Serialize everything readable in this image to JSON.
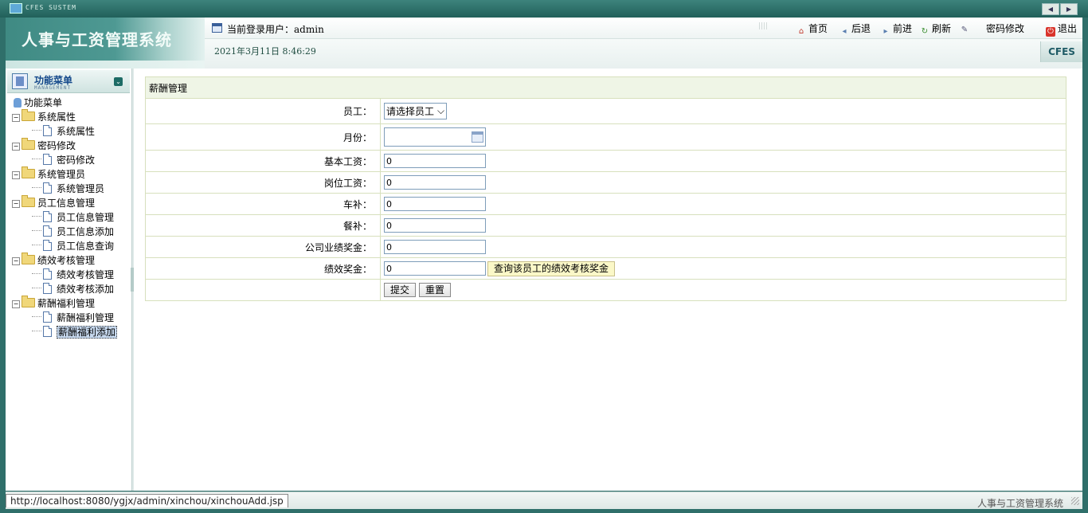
{
  "window": {
    "system_text": "CFES SUSTEM"
  },
  "header": {
    "app_title": "人事与工资管理系统",
    "user_label": "当前登录用户：",
    "username": "admin",
    "datetime": "2021年3月11日 8:46:29",
    "nav": {
      "home": "首页",
      "back": "后退",
      "forward": "前进",
      "refresh": "刷新",
      "change_password": "密码修改",
      "logout": "退出"
    },
    "brand_tab": "CFES"
  },
  "sidebar": {
    "title": "功能菜单",
    "subtitle": "MANAGEMENT",
    "root": "功能菜单",
    "groups": [
      {
        "label": "系统属性",
        "items": [
          "系统属性"
        ]
      },
      {
        "label": "密码修改",
        "items": [
          "密码修改"
        ]
      },
      {
        "label": "系统管理员",
        "items": [
          "系统管理员"
        ]
      },
      {
        "label": "员工信息管理",
        "items": [
          "员工信息管理",
          "员工信息添加",
          "员工信息查询"
        ]
      },
      {
        "label": "绩效考核管理",
        "items": [
          "绩效考核管理",
          "绩效考核添加"
        ]
      },
      {
        "label": "薪酬福利管理",
        "items": [
          "薪酬福利管理",
          "薪酬福利添加"
        ]
      }
    ],
    "selected_item": "薪酬福利添加"
  },
  "form": {
    "caption": "薪酬管理",
    "fields": {
      "employee": {
        "label": "员工：",
        "value": "请选择员工"
      },
      "month": {
        "label": "月份：",
        "value": ""
      },
      "base_salary": {
        "label": "基本工资：",
        "value": "0"
      },
      "post_salary": {
        "label": "岗位工资：",
        "value": "0"
      },
      "car_allowance": {
        "label": "车补：",
        "value": "0"
      },
      "meal_allowance": {
        "label": "餐补：",
        "value": "0"
      },
      "company_bonus": {
        "label": "公司业绩奖金：",
        "value": "0"
      },
      "performance_bonus": {
        "label": "绩效奖金：",
        "value": "0"
      }
    },
    "query_button": "查询该员工的绩效考核奖金",
    "submit": "提交",
    "reset": "重置"
  },
  "status": {
    "url": "http://localhost:8080/ygjx/admin/xinchou/xinchouAdd.jsp",
    "right_text": "人事与工资管理系统"
  }
}
